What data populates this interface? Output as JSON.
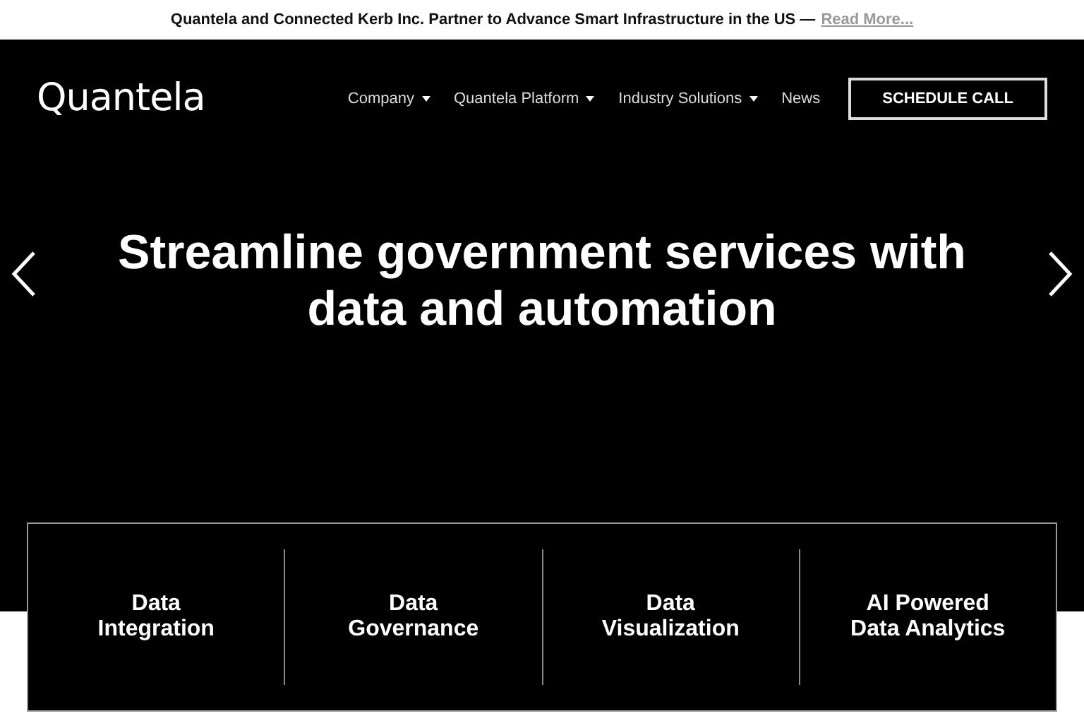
{
  "announcement": {
    "text": "Quantela and Connected Kerb Inc. Partner to Advance Smart Infrastructure in the US —",
    "link": "Read More..."
  },
  "header": {
    "logo": "Quantela",
    "nav": [
      {
        "label": "Company",
        "dropdown": true
      },
      {
        "label": "Quantela Platform",
        "dropdown": true
      },
      {
        "label": "Industry Solutions",
        "dropdown": true
      },
      {
        "label": "News",
        "dropdown": false
      }
    ],
    "cta": "SCHEDULE CALL"
  },
  "hero": {
    "headline": "Streamline government services with data and automation"
  },
  "features": [
    {
      "line1": "Data",
      "line2": "Integration"
    },
    {
      "line1": "Data",
      "line2": "Governance"
    },
    {
      "line1": "Data",
      "line2": "Visualization"
    },
    {
      "line1": "AI Powered",
      "line2": "Data Analytics"
    }
  ]
}
